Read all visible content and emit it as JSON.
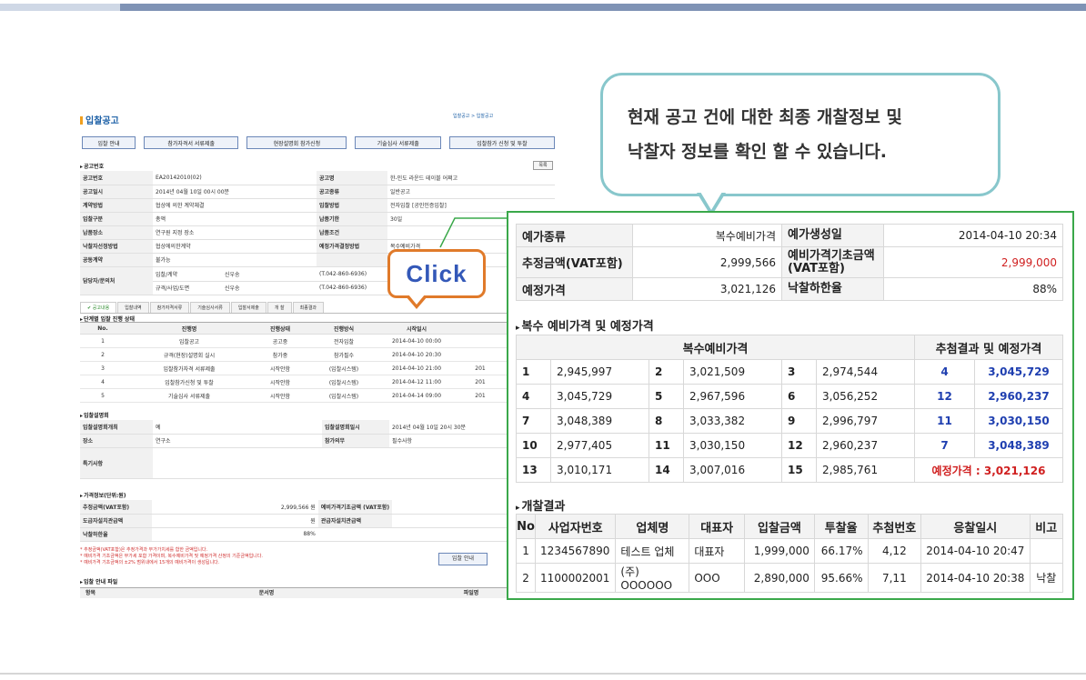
{
  "callout": {
    "line1": "현재 공고 건에 대한 최종 개찰정보 및",
    "line2": "낙찰자 정보를 확인 할 수 있습니다."
  },
  "click_label": "Click",
  "bg": {
    "title": "입찰공고",
    "breadcrumb": "입찰공고 > 입찰공고",
    "buttons": [
      "입찰 안내",
      "참가자격서 서류제출",
      "현장설명회 참가신청",
      "기술심사 서류제출",
      "입찰참가 신청 및 투찰"
    ],
    "sec_notice": "공고번호",
    "list_btn": "목록",
    "info": [
      [
        "공고번호",
        "EA20142010(02)",
        "공고명",
        "한-인도 라운드 테이블 어쩌고"
      ],
      [
        "공고일시",
        "2014년 04월 10일 00시 00분",
        "공고종류",
        "일반공고"
      ],
      [
        "계약방법",
        "협상에 의한 계약체결",
        "입찰방법",
        "전자입찰 [공인인증입찰]"
      ],
      [
        "입찰구분",
        "총액",
        "납품기한",
        "30일"
      ],
      [
        "납품장소",
        "연구원 지정 장소",
        "납품조건",
        ""
      ],
      [
        "낙찰자선정방법",
        "협상에의한계약",
        "예정가격결정방법",
        "복수예비가격"
      ],
      [
        "공동계약",
        "불가능",
        "",
        ""
      ]
    ],
    "contact_label": "담당자/문의처",
    "contacts": [
      [
        "입찰/계약",
        "신우송",
        "(T.042-860-6936)"
      ],
      [
        "규격/사업/도면",
        "신우송",
        "(T.042-860-6936)"
      ]
    ],
    "tabs": [
      "공고내용",
      "입찰내역",
      "참가자격서류",
      "기술심사서류",
      "입찰서제출",
      "개 찰",
      "최종결과"
    ],
    "sec_stage": "단계별 입찰 진행 상태",
    "stage_headers": [
      "No.",
      "진행명",
      "진행상태",
      "진행방식",
      "시작일시",
      ""
    ],
    "stages": [
      [
        "1",
        "입찰공고",
        "공고중",
        "전자입찰",
        "2014-04-10 00:00",
        ""
      ],
      [
        "2",
        "규격(현장)설명회 실시",
        "참가중",
        "참가필수",
        "2014-04-10 20:30",
        ""
      ],
      [
        "3",
        "입찰참가자격 서류제출",
        "시작안함",
        "(입찰시스템)",
        "2014-04-10 21:00",
        "201"
      ],
      [
        "4",
        "입찰참가신청 및 투찰",
        "시작안함",
        "(입찰시스템)",
        "2014-04-12 11:00",
        "201"
      ],
      [
        "5",
        "기술심사 서류제출",
        "시작안함",
        "(입찰시스템)",
        "2014-04-14 09:00",
        "201"
      ]
    ],
    "sec_briefing": "입찰설명회",
    "briefing": [
      [
        "입찰설명회개최",
        "예",
        "입찰설명회일시",
        "2014년 04월 10일 20시 30분"
      ],
      [
        "장소",
        "연구소",
        "참가의무",
        "필수사항"
      ],
      [
        "특기사항",
        "",
        "",
        ""
      ]
    ],
    "sec_price": "가격정보(단위:원)",
    "price": [
      [
        "추정금액(VAT포함)",
        "2,999,566 원",
        "예비가격기초금액 (VAT포함)",
        ""
      ],
      [
        "도급자설치관급액",
        "원",
        "관급자설치관급액",
        ""
      ],
      [
        "낙찰하한율",
        "88%",
        "",
        ""
      ]
    ],
    "notes": [
      "* 추정금액(VAT포함)은 추정가격과 부가가치세를 합한 금액입니다.",
      "* 예비가격 기초금액은 부가세 포함 가격이며, 복수예비가격 및 예정가격 산정의 기준금액입니다.",
      "* 예비가격 기초금액의 ±2% 범위내에서 15개의 예비가격이 생성됩니다."
    ],
    "guide_btn": "입찰 안내",
    "sec_file": "입찰 안내 파일",
    "file_headers": [
      "항목",
      "문서명",
      "파일명"
    ]
  },
  "panel": {
    "summary": [
      {
        "label": "예가종류",
        "value": "복수예비가격",
        "label2": "예가생성일",
        "value2": "2014-04-10 20:34"
      },
      {
        "label": "추정금액(VAT포함)",
        "value": "2,999,566",
        "label2": "예비가격기초금액\n(VAT포함)",
        "value2": "2,999,000"
      },
      {
        "label": "예정가격",
        "value": "3,021,126",
        "label2": "낙찰하한율",
        "value2": "88%"
      }
    ],
    "sec_multi": "복수 예비가격 및 예정가격",
    "multi_header_left": "복수예비가격",
    "multi_header_right": "추첨결과 및 예정가격",
    "multi_rows": [
      [
        [
          "1",
          "2,945,997"
        ],
        [
          "2",
          "3,021,509"
        ],
        [
          "3",
          "2,974,544"
        ],
        [
          "4",
          "3,045,729"
        ]
      ],
      [
        [
          "4",
          "3,045,729"
        ],
        [
          "5",
          "2,967,596"
        ],
        [
          "6",
          "3,056,252"
        ],
        [
          "12",
          "2,960,237"
        ]
      ],
      [
        [
          "7",
          "3,048,389"
        ],
        [
          "8",
          "3,033,382"
        ],
        [
          "9",
          "2,996,797"
        ],
        [
          "11",
          "3,030,150"
        ]
      ],
      [
        [
          "10",
          "2,977,405"
        ],
        [
          "11",
          "3,030,150"
        ],
        [
          "12",
          "2,960,237"
        ],
        [
          "7",
          "3,048,389"
        ]
      ],
      [
        [
          "13",
          "3,010,171"
        ],
        [
          "14",
          "3,007,016"
        ],
        [
          "15",
          "2,985,761"
        ]
      ]
    ],
    "planned_price": "예정가격 : 3,021,126",
    "sec_result": "개찰결과",
    "result_headers": [
      "No",
      "사업자번호",
      "업체명",
      "대표자",
      "입찰금액",
      "투찰율",
      "추첨번호",
      "응찰일시",
      "비고"
    ],
    "results": [
      [
        "1",
        "1234567890",
        "테스트 업체",
        "대표자",
        "1,999,000",
        "66.17%",
        "4,12",
        "2014-04-10 20:47",
        ""
      ],
      [
        "2",
        "1100002001",
        "(주) OOOOOO",
        "OOO",
        "2,890,000",
        "95.66%",
        "7,11",
        "2014-04-10 20:38",
        "낙찰"
      ]
    ]
  },
  "colors": {
    "accent_blue": "#1f3fb0",
    "red": "#d02020",
    "panel_border": "#3aa84a",
    "bubble_border": "#88c7cc",
    "click_border": "#e07a2a"
  }
}
